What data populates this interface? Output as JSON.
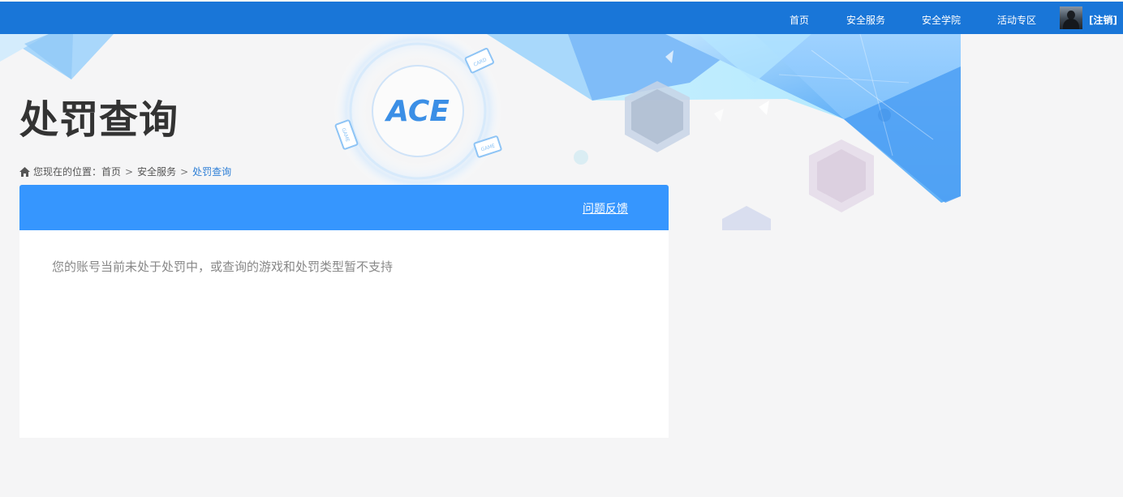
{
  "nav": {
    "items": [
      {
        "label": "首页"
      },
      {
        "label": "安全服务"
      },
      {
        "label": "安全学院"
      },
      {
        "label": "活动专区"
      }
    ],
    "logout_label": "[注销]"
  },
  "banner": {
    "logo_text": "ACE",
    "card_labels": [
      "CARD",
      "GAME",
      "GAME"
    ]
  },
  "page": {
    "title": "处罚查询"
  },
  "breadcrumb": {
    "prefix": "您现在的位置：",
    "items": [
      "首页",
      "安全服务"
    ],
    "current": "处罚查询",
    "separator": ">"
  },
  "card": {
    "feedback_label": "问题反馈",
    "message": "您的账号当前未处于处罚中，或查询的游戏和处罚类型暂不支持"
  },
  "colors": {
    "topbar": "#1976d8",
    "card_header": "#3696fe",
    "link_current": "#2e7fd6",
    "page_bg": "#f5f5f6"
  }
}
